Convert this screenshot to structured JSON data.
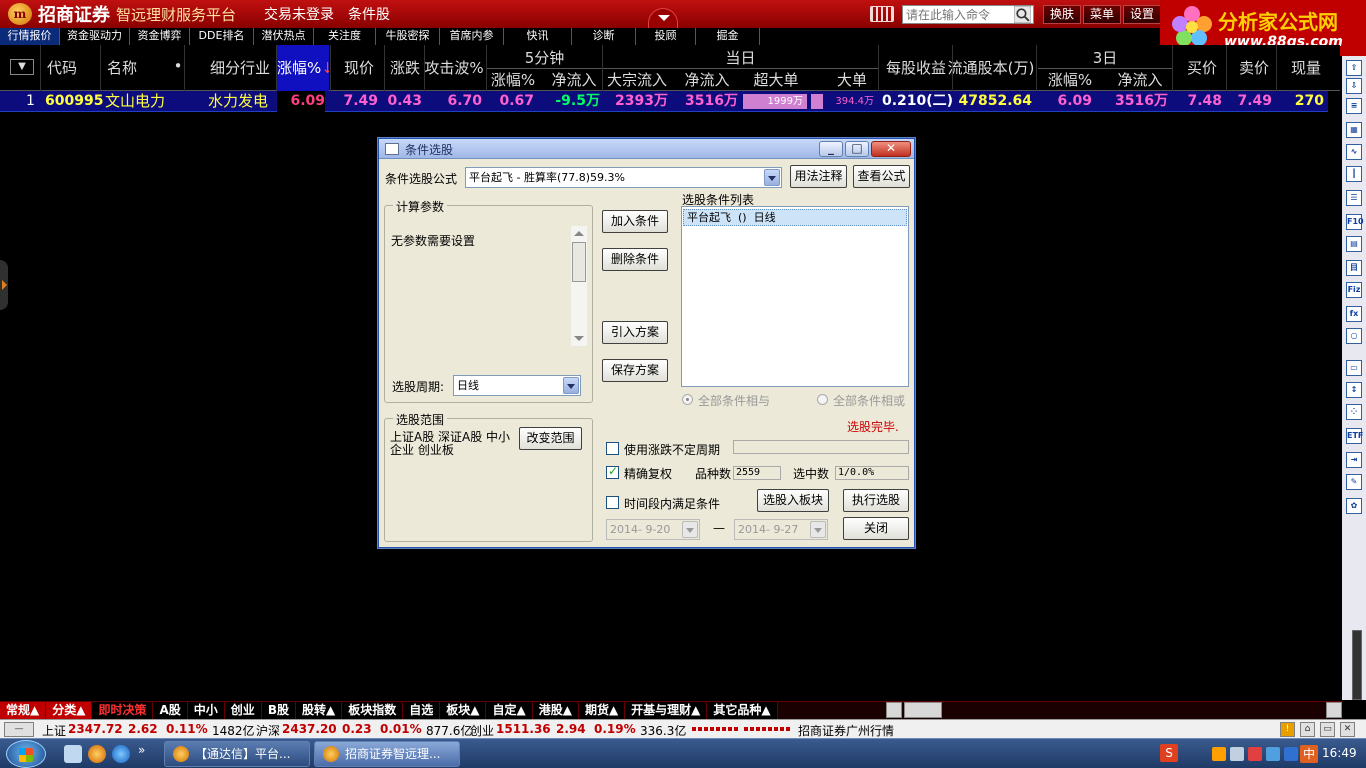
{
  "titlebar": {
    "logo_text": "m",
    "brand": "招商证券",
    "brand_sub": "智远理财服务平台",
    "login_status": "交易未登录",
    "stock_selection": "条件股",
    "cmd_placeholder": "请在此输入命令",
    "buttons": [
      "换肤",
      "菜单",
      "设置"
    ]
  },
  "site_logo": {
    "name": "分析家公式网",
    "url": "www.88gs.com"
  },
  "subnav": [
    "行情报价",
    "资金驱动力",
    "资金博弈",
    "DDE排名",
    "潜伏热点",
    "关注度",
    "牛股密探",
    "首席内参",
    "快讯",
    "诊断",
    "投顾",
    "掘金"
  ],
  "table": {
    "groups": {
      "min5": "5分钟",
      "today": "当日",
      "d3": "3日"
    },
    "headers": {
      "code": "代码",
      "name": "名称",
      "dot": "•",
      "industry": "细分行业",
      "change_pct": "涨幅%",
      "price": "现价",
      "change": "涨跌",
      "attack": "攻击波%",
      "m5_change": "涨幅%",
      "m5_inflow": "净流入",
      "block_inflow": "大宗流入",
      "net_inflow": "净流入",
      "super_order": "超大单",
      "big_order": "大单",
      "eps": "每股收益",
      "float_shares": "流通股本(万)",
      "d3_change": "涨幅%",
      "d3_inflow": "净流入",
      "bid": "买价",
      "ask": "卖价",
      "volume": "现量"
    },
    "rows": [
      {
        "idx": "1",
        "code": "600995",
        "name": "文山电力",
        "industry": "水力发电",
        "change_pct": "6.09",
        "price": "7.49",
        "change": "0.43",
        "attack": "6.70",
        "m5_change": "0.67",
        "m5_inflow": "-9.5万",
        "block_inflow": "2393万",
        "net_inflow": "3516万",
        "super_order": "1999万",
        "big_order": "394.4万",
        "eps": "0.210(二)",
        "float_shares": "47852.64",
        "d3_change": "6.09",
        "d3_inflow": "3516万",
        "bid": "7.48",
        "ask": "7.49",
        "volume": "270"
      }
    ]
  },
  "dialog": {
    "title": "条件选股",
    "formula_label": "条件选股公式",
    "formula_value": "平台起飞 - 胜算率(77.8)59.3%",
    "btn_usage": "用法注释",
    "btn_view": "查看公式",
    "calc_params_title": "计算参数",
    "no_params": "无参数需要设置",
    "period_label": "选股周期:",
    "period_value": "日线",
    "range_title": "选股范围",
    "range_text": "上证A股 深证A股 中小企业 创业板",
    "btn_change_range": "改变范围",
    "btn_add": "加入条件",
    "btn_delete": "删除条件",
    "btn_import": "引入方案",
    "btn_save": "保存方案",
    "cond_list_title": "选股条件列表",
    "cond_items": [
      "平台起飞  ()  日线"
    ],
    "radio_and": "全部条件相与",
    "radio_or": "全部条件相或",
    "status": "选股完毕.",
    "chk_variable_period": "使用涨跌不定周期",
    "chk_precise": "精确复权",
    "count_label": "品种数",
    "count_value": "2559",
    "selected_label": "选中数",
    "selected_value": "1/0.0%",
    "chk_time_range": "时间段内满足条件",
    "btn_to_block": "选股入板块",
    "btn_execute": "执行选股",
    "date_from": "2014- 9-20",
    "date_sep": "—",
    "date_to": "2014- 9-27",
    "btn_close": "关闭"
  },
  "bottom_tabs": [
    "常规▲",
    "分类▲",
    "即时决策",
    "A股",
    "中小",
    "创业",
    "B股",
    "股转▲",
    "板块指数",
    "自选",
    "板块▲",
    "自定▲",
    "港股▲",
    "期货▲",
    "开基与理财▲",
    "其它品种▲"
  ],
  "status_bar": {
    "sh_label": "上证",
    "sh_index": "2347.72",
    "sh_change": "2.62",
    "sh_pct": "0.11%",
    "sh_amount": "1482亿",
    "hs_label": "沪深",
    "hs_index": "2437.20",
    "hs_change": "0.23",
    "hs_pct": "0.01%",
    "hs_amount": "877.6亿",
    "cy_label": "创业",
    "cy_index": "1511.36",
    "cy_change": "2.94",
    "cy_pct": "0.19%",
    "cy_amount": "336.3亿",
    "broker": "招商证券广州行情"
  },
  "taskbar": {
    "tasks": [
      "【通达信】平台...",
      "招商证券智远理..."
    ],
    "ime": "中",
    "time": "16:49"
  },
  "colors": {
    "title_red": "#c01010",
    "row_blue": "#0c0c7c",
    "up_red": "#ff4080",
    "yellow": "#ffff40"
  }
}
